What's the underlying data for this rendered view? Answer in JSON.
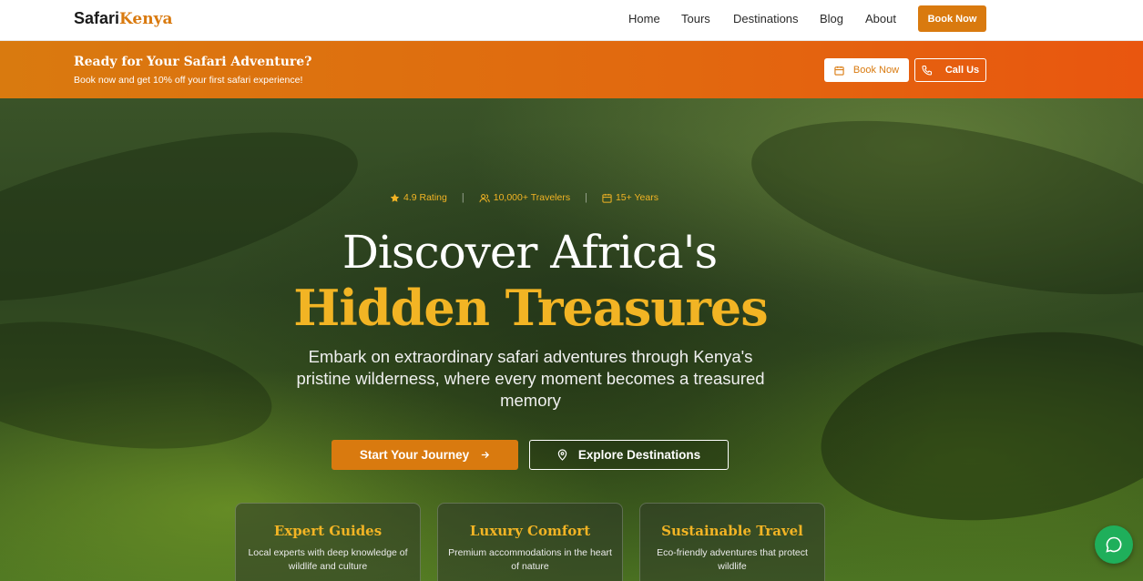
{
  "nav": {
    "logo_main": "Safari",
    "logo_accent": "Kenya",
    "links": [
      "Home",
      "Tours",
      "Destinations",
      "Blog",
      "About"
    ],
    "book_label": "Book Now"
  },
  "promo": {
    "title": "Ready for Your Safari Adventure?",
    "subtitle": "Book now and get 10% off your first safari experience!",
    "book_label": "Book Now",
    "call_label": "Call Us"
  },
  "hero": {
    "stats": [
      {
        "icon": "star-icon",
        "label": "4.9 Rating"
      },
      {
        "icon": "users-icon",
        "label": "10,000+ Travelers"
      },
      {
        "icon": "calendar-icon",
        "label": "15+ Years"
      }
    ],
    "heading_line1": "Discover Africa's",
    "heading_line2": "Hidden Treasures",
    "description": "Embark on extraordinary safari adventures through Kenya's pristine wilderness, where every moment becomes a treasured memory",
    "primary_cta": "Start Your Journey",
    "secondary_cta": "Explore Destinations"
  },
  "features": [
    {
      "title": "Expert Guides",
      "text": "Local experts with deep knowledge of wildlife and culture"
    },
    {
      "title": "Luxury Comfort",
      "text": "Premium accommodations in the heart of nature"
    },
    {
      "title": "Sustainable Travel",
      "text": "Eco-friendly adventures that protect wildlife"
    }
  ],
  "colors": {
    "accent": "#d97a0f",
    "gold": "#f2b424",
    "chat": "#1faf5b"
  }
}
